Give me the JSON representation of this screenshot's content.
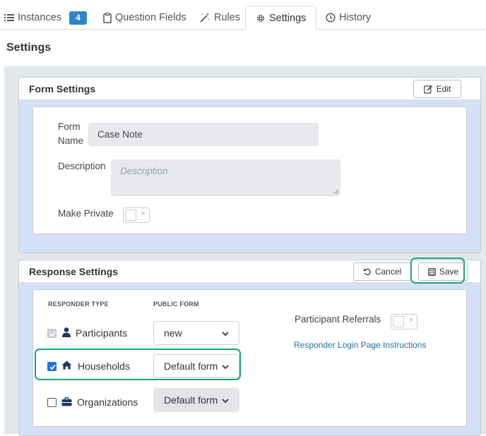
{
  "tabs": {
    "instances": {
      "label": "Instances",
      "count": "4"
    },
    "question_fields": {
      "label": "Question Fields"
    },
    "rules": {
      "label": "Rules"
    },
    "settings": {
      "label": "Settings"
    },
    "history": {
      "label": "History"
    }
  },
  "page": {
    "title": "Settings"
  },
  "form_settings": {
    "title": "Form Settings",
    "edit_label": "Edit",
    "form_name_label": "Form\nName",
    "form_name_value": "Case Note",
    "description_label": "Description",
    "description_placeholder": "Description",
    "make_private_label": "Make Private",
    "toggle_off_symbol": "×"
  },
  "response_settings": {
    "title": "Response Settings",
    "cancel_label": "Cancel",
    "save_label": "Save",
    "col_responder_type": "RESPONDER TYPE",
    "col_public_form": "PUBLIC FORM",
    "rows": [
      {
        "label": "Participants",
        "icon": "user-icon",
        "checked": true,
        "disabled": true,
        "form": "new"
      },
      {
        "label": "Households",
        "icon": "home-icon",
        "checked": true,
        "disabled": false,
        "form": "Default form"
      },
      {
        "label": "Organizations",
        "icon": "briefcase-icon",
        "checked": false,
        "disabled": false,
        "form": "Default form"
      }
    ],
    "participant_referrals_label": "Participant Referrals",
    "toggle_off_symbol": "×",
    "login_link": "Responder Login Page Instructions"
  },
  "colors": {
    "accent": "#2f83c6",
    "highlight": "#1aa37d",
    "checkbox": "#1a73e8"
  }
}
